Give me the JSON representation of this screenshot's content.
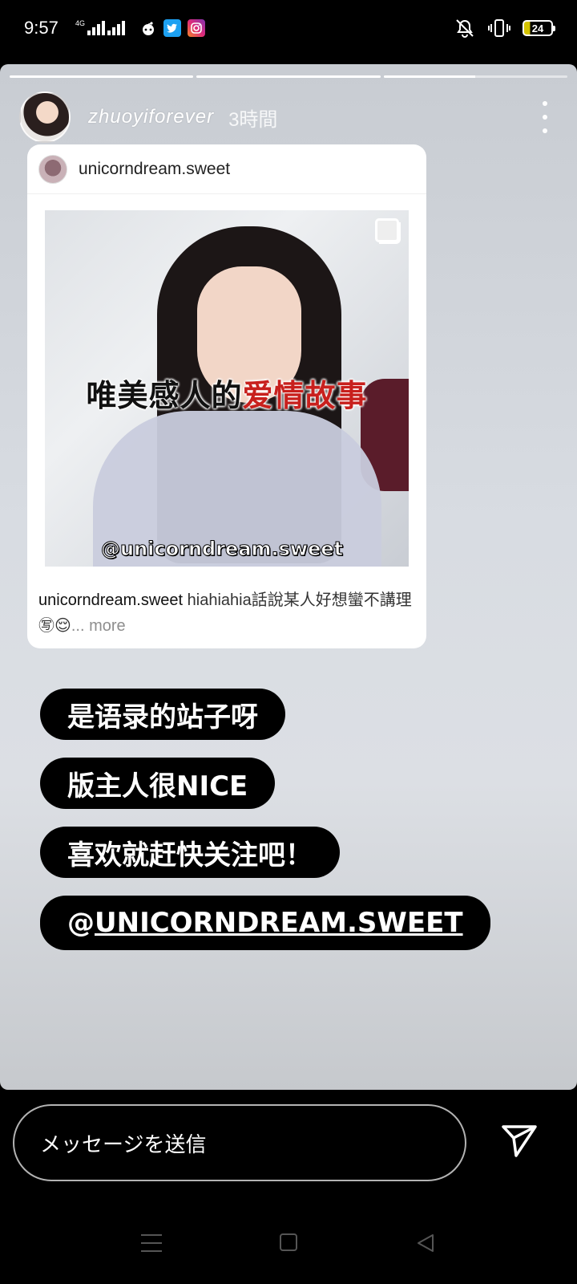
{
  "status_bar": {
    "time": "9:57",
    "network": "4G",
    "battery": "24",
    "apps": [
      "reddit-icon",
      "twitter-icon",
      "instagram-icon"
    ]
  },
  "story": {
    "username": "zhuoyiforever",
    "time_ago": "3時間",
    "progress_segments": [
      1.0,
      1.0,
      0.5
    ]
  },
  "post": {
    "username": "unicorndream.sweet",
    "image_title_black": "唯美感人的",
    "image_title_red": "爱情故事",
    "image_watermark": "@unicorndream.sweet",
    "caption_user": "unicorndream.sweet",
    "caption_text": " hiahiahia話說某人好想蠻不講理㊢😌",
    "caption_more": "... more"
  },
  "stickers": {
    "line1": "是语录的站子呀",
    "line2": "版主人很NICE",
    "line3": "喜欢就赶快关注吧！",
    "mention_prefix": "@",
    "mention": "UNICORNDREAM.SWEET"
  },
  "message_bar": {
    "placeholder": "メッセージを送信"
  },
  "colors": {
    "title_red": "#c8201d",
    "twitter": "#1da1f2"
  }
}
